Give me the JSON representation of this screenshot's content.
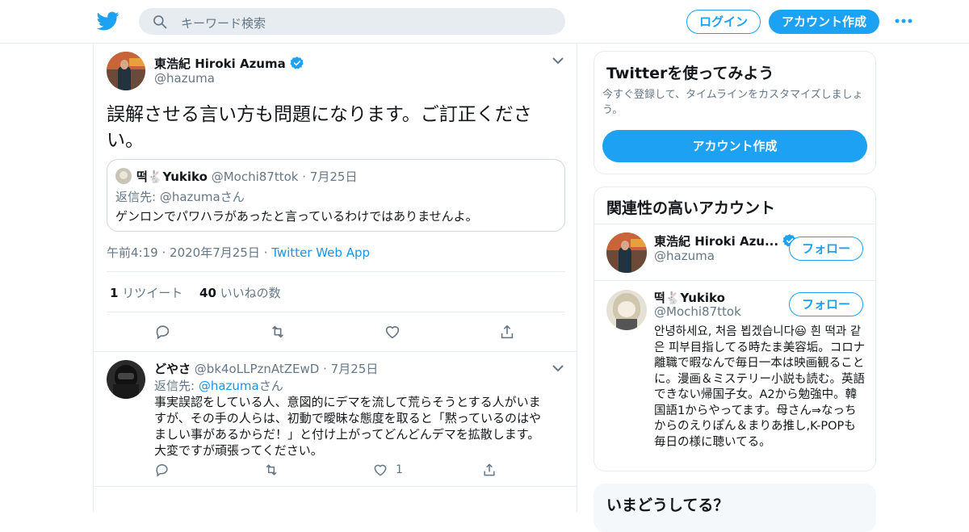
{
  "header": {
    "search_placeholder": "キーワード検索",
    "login_label": "ログイン",
    "signup_label": "アカウント作成",
    "brand_color": "#1da1f2"
  },
  "tweet": {
    "author_name": "東浩紀 Hiroki Azuma",
    "author_handle": "@hazuma",
    "text": "誤解させる言い方も問題になります。ご訂正ください。",
    "quote": {
      "name": "떡🐇Yukiko",
      "handle": "@Mochi87ttok",
      "date": "7月25日",
      "reply_to_label": "返信先: ",
      "reply_to_handle": "@hazuma",
      "reply_to_suffix": "さん",
      "text": "ゲンロンでパワハラがあったと言っているわけではありませんよ。"
    },
    "time": "午前4:19",
    "date": "2020年7月25日",
    "source": "Twitter Web App",
    "retweet_count": "1",
    "retweet_label": "リツイート",
    "like_count": "40",
    "like_label": "いいねの数"
  },
  "reply": {
    "name": "どやさ",
    "handle": "@bk4oLLPznAtZEwD",
    "date": "7月25日",
    "reply_to_label": "返信先: ",
    "reply_to_handle": "@hazuma",
    "reply_to_suffix": "さん",
    "text": "事実誤認をしている人、意図的にデマを流して荒らそうとする人がいますが、その手の人らは、初動で曖昧な態度を取ると「黙っているのはやましい事があるからだ！」と付け上がってどんどんデマを拡散します。大変ですが頑張ってください。",
    "like_count": "1"
  },
  "sidebar": {
    "try_card": {
      "title": "Twitterを使ってみよう",
      "desc": "今すぐ登録して、タイムラインをカスタマイズしましょう。",
      "button": "アカウント作成"
    },
    "related": {
      "title": "関連性の高いアカウント",
      "accounts": [
        {
          "name": "東浩紀 Hiroki Azu...",
          "handle": "@hazuma",
          "follow": "フォロー",
          "verified": true
        },
        {
          "name": "떡🐇Yukiko",
          "handle": "@Mochi87ttok",
          "follow": "フォロー",
          "bio": "안녕하세요, 처음 뵙겠습니다😃 흰 떡과 같은 피부目指してる時たま美容垢。コロナ離職で暇なんで毎日一本は映画観ることに。漫画＆ミステリー小説も読む。英語できない帰国子女。A2から勉強中。韓国語1からやってます。母さん⇒なっちからのえりぽん＆まりあ推し,K-POPも毎日の様に聴いてる。"
        }
      ]
    },
    "whats_happening": {
      "title": "いまどうしてる？"
    }
  }
}
